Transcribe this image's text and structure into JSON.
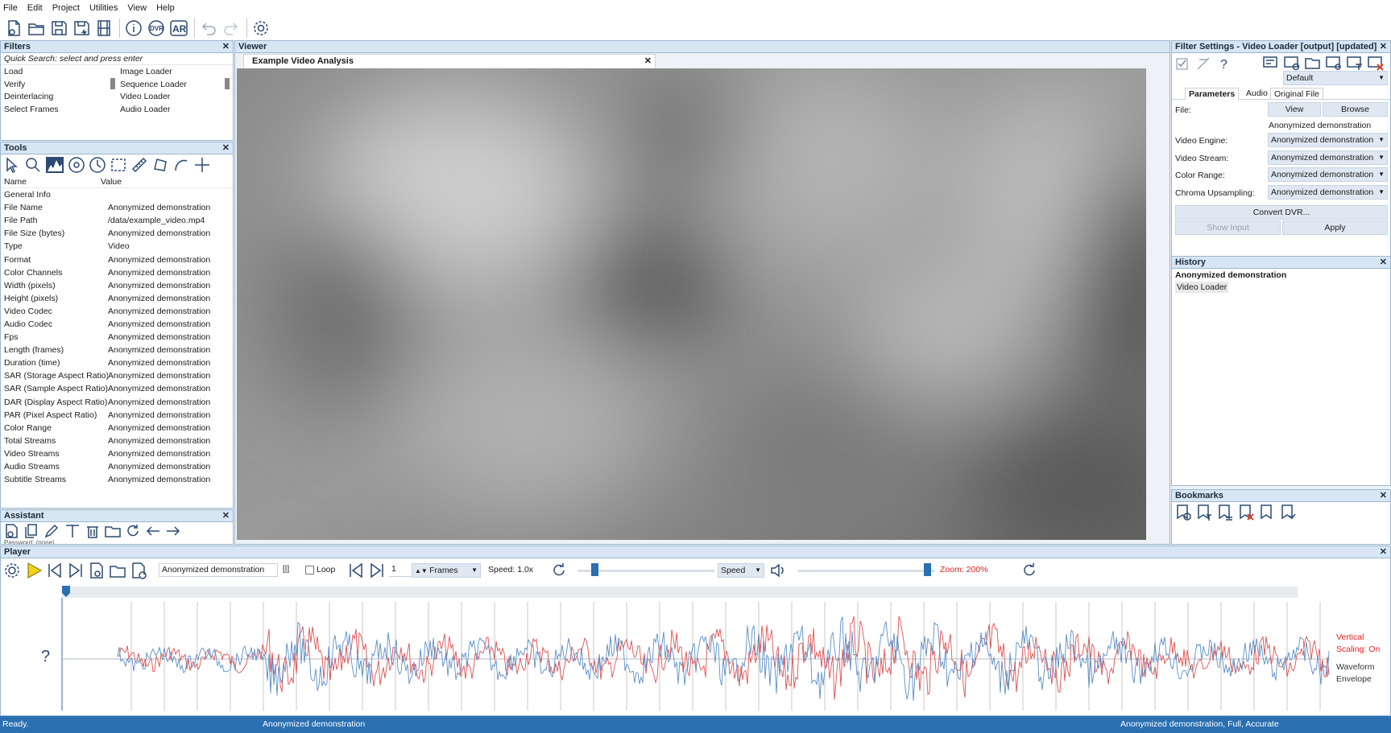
{
  "menu": [
    "File",
    "Edit",
    "Project",
    "Utilities",
    "View",
    "Help"
  ],
  "toolbar_icons": [
    "new-project-icon",
    "open-icon",
    "save-icon",
    "save-as-icon",
    "film-icon",
    "info-icon",
    "dvr-icon",
    "ar-icon",
    "undo-icon",
    "redo-icon",
    "settings-icon"
  ],
  "toolbar_dvr": "DVR",
  "toolbar_ar": "AR",
  "filters": {
    "title": "Filters",
    "search_placeholder": "Quick Search: select and press enter",
    "categories": [
      "Load",
      "Verify",
      "Deinterlacing",
      "Select Frames"
    ],
    "items": [
      "Image Loader",
      "Sequence Loader",
      "Video Loader",
      "Audio Loader"
    ]
  },
  "tools": {
    "title": "Tools",
    "col_name": "Name",
    "col_value": "Value",
    "rows": [
      {
        "n": "General Info",
        "v": ""
      },
      {
        "n": "File Name",
        "v": "Anonymized demonstration"
      },
      {
        "n": "File Path",
        "v": "/data/example_video.mp4"
      },
      {
        "n": "File Size (bytes)",
        "v": "Anonymized demonstration"
      },
      {
        "n": "Type",
        "v": "Video"
      },
      {
        "n": "Format",
        "v": "Anonymized demonstration"
      },
      {
        "n": "Color Channels",
        "v": "Anonymized demonstration"
      },
      {
        "n": "Width (pixels)",
        "v": "Anonymized demonstration"
      },
      {
        "n": "Height (pixels)",
        "v": "Anonymized demonstration"
      },
      {
        "n": "Video Codec",
        "v": "Anonymized demonstration"
      },
      {
        "n": "Audio Codec",
        "v": "Anonymized demonstration"
      },
      {
        "n": "Fps",
        "v": "Anonymized demonstration"
      },
      {
        "n": "Length (frames)",
        "v": "Anonymized demonstration"
      },
      {
        "n": "Duration (time)",
        "v": "Anonymized demonstration"
      },
      {
        "n": "SAR (Storage Aspect Ratio)",
        "v": "Anonymized demonstration"
      },
      {
        "n": "SAR (Sample Aspect Ratio)",
        "v": "Anonymized demonstration"
      },
      {
        "n": "DAR (Display Aspect Ratio)",
        "v": "Anonymized demonstration"
      },
      {
        "n": "PAR (Pixel Aspect Ratio)",
        "v": "Anonymized demonstration"
      },
      {
        "n": "Color Range",
        "v": "Anonymized demonstration"
      },
      {
        "n": "Total Streams",
        "v": "Anonymized demonstration"
      },
      {
        "n": "Video Streams",
        "v": "Anonymized demonstration"
      },
      {
        "n": "Audio Streams",
        "v": "Anonymized demonstration"
      },
      {
        "n": "Subtitle Streams",
        "v": "Anonymized demonstration"
      }
    ]
  },
  "assistant": {
    "title": "Assistant",
    "footer_text": "Password: (none)"
  },
  "viewer": {
    "title": "Viewer",
    "tab": "Example Video Analysis"
  },
  "filter_settings": {
    "title": "Filter Settings - Video Loader [output] [updated]",
    "preset": "Default",
    "tabs": [
      "Parameters",
      "Audio",
      "Original File"
    ],
    "file_label": "File:",
    "view_button": "View",
    "browse_button": "Browse",
    "file_value": "Anonymized demonstration",
    "fields": [
      {
        "label": "Video Engine:",
        "value": "Anonymized demonstration"
      },
      {
        "label": "Video Stream:",
        "value": "Anonymized demonstration"
      },
      {
        "label": "Color Range:",
        "value": "Anonymized demonstration"
      },
      {
        "label": "Chroma Upsampling:",
        "value": "Anonymized demonstration"
      }
    ],
    "convert_button": "Convert DVR...",
    "show_input_button": "Show Input",
    "apply_button": "Apply"
  },
  "history": {
    "title": "History",
    "heading": "Anonymized demonstration",
    "item": "Video Loader"
  },
  "bookmarks": {
    "title": "Bookmarks"
  },
  "player": {
    "title": "Player",
    "file_name": "Anonymized demonstration",
    "marker": "[|]",
    "loop_label": "Loop",
    "frame_value": "1",
    "unit": "Frames",
    "speed_text": "Speed: 1.0x",
    "speed_mode": "Speed",
    "zoom_text": "Zoom: 200%",
    "help_mark": "?",
    "vertical_scaling_1": "Vertical",
    "vertical_scaling_2": "Scaling: On",
    "waveform_1": "Waveform",
    "waveform_2": "Envelope",
    "zoom_color": "#e02020",
    "scaling_color": "#e02020"
  },
  "status": {
    "left": "Ready.",
    "mid": "Anonymized demonstration",
    "right": "Anonymized demonstration, Full, Accurate"
  }
}
